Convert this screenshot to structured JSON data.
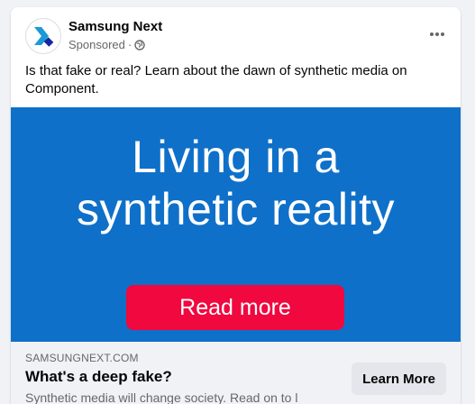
{
  "post": {
    "page_name": "Samsung Next",
    "sponsored_label": "Sponsored",
    "separator": "·",
    "privacy_icon": "globe-icon",
    "more_icon": "ellipsis-icon",
    "text": "Is that fake or real? Learn about the dawn of synthetic media on Component."
  },
  "creative": {
    "headline_line1": "Living in a",
    "headline_line2": "synthetic reality",
    "button_label": "Read more",
    "background_color": "#0f70c9",
    "button_color": "#f0083f"
  },
  "link": {
    "domain": "SAMSUNGNEXT.COM",
    "title": "What's a deep fake?",
    "description": "Synthetic media will change society. Read on to l",
    "cta_label": "Learn More"
  },
  "colors": {
    "brand_logo_blue": "#1428a0",
    "brand_logo_cyan": "#1a9ad6"
  }
}
